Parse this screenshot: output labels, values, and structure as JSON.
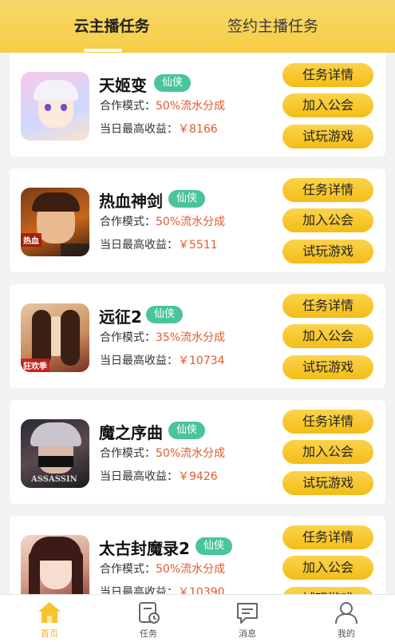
{
  "tabs": [
    {
      "label": "云主播任务",
      "active": true
    },
    {
      "label": "签约主播任务",
      "active": false
    }
  ],
  "colors": {
    "accent": "#f6cd45",
    "genre_tag": "#49c49c",
    "value_text": "#e25a2b"
  },
  "row_labels": {
    "mode": "合作模式：",
    "earnings": "当日最高收益："
  },
  "buttons": {
    "details": "任务详情",
    "join": "加入公会",
    "trial": "试玩游戏"
  },
  "games": [
    {
      "name": "天姬变",
      "genre": "仙侠",
      "mode": "50%流水分成",
      "earnings": "￥8166",
      "thumb_label": ""
    },
    {
      "name": "热血神剑",
      "genre": "仙侠",
      "mode": "50%流水分成",
      "earnings": "￥5511",
      "thumb_label": "热血"
    },
    {
      "name": "远征2",
      "genre": "仙侠",
      "mode": "35%流水分成",
      "earnings": "￥10734",
      "thumb_label": "狂欢季"
    },
    {
      "name": "魔之序曲",
      "genre": "仙侠",
      "mode": "50%流水分成",
      "earnings": "￥9426",
      "thumb_label": "ASSASSIN"
    },
    {
      "name": "太古封魔录2",
      "genre": "仙侠",
      "mode": "50%流水分成",
      "earnings": "￥10390",
      "thumb_label": ""
    }
  ],
  "bottom_nav": [
    {
      "label": "首页",
      "icon": "home-icon",
      "active": true
    },
    {
      "label": "任务",
      "icon": "task-icon",
      "active": false
    },
    {
      "label": "消息",
      "icon": "message-icon",
      "active": false
    },
    {
      "label": "我的",
      "icon": "user-icon",
      "active": false
    }
  ]
}
